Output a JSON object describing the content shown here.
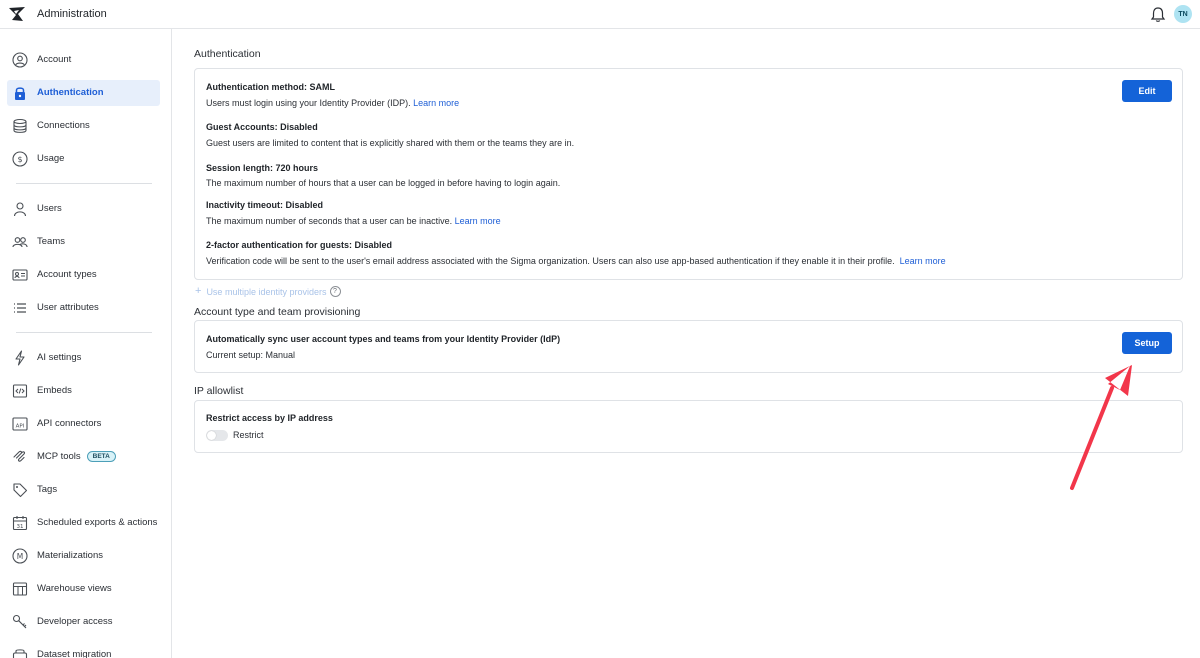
{
  "app": {
    "title": "Administration",
    "avatar_initials": "TN"
  },
  "sidebar": {
    "active": "Authentication",
    "items": [
      {
        "label": "Account",
        "icon": "account-icon"
      },
      {
        "label": "Authentication",
        "icon": "lock-icon"
      },
      {
        "label": "Connections",
        "icon": "database-icon"
      },
      {
        "label": "Usage",
        "icon": "usage-icon"
      },
      {
        "label": "Users",
        "icon": "user-icon"
      },
      {
        "label": "Teams",
        "icon": "teams-icon"
      },
      {
        "label": "Account types",
        "icon": "id-card-icon"
      },
      {
        "label": "User attributes",
        "icon": "list-icon"
      },
      {
        "label": "AI settings",
        "icon": "lightning-icon"
      },
      {
        "label": "Embeds",
        "icon": "embed-icon"
      },
      {
        "label": "API connectors",
        "icon": "api-icon"
      },
      {
        "label": "MCP tools",
        "icon": "mcp-icon",
        "badge": "BETA"
      },
      {
        "label": "Tags",
        "icon": "tag-icon"
      },
      {
        "label": "Scheduled exports & actions",
        "icon": "calendar-icon"
      },
      {
        "label": "Materializations",
        "icon": "materialization-icon"
      },
      {
        "label": "Warehouse views",
        "icon": "table-icon"
      },
      {
        "label": "Developer access",
        "icon": "key-icon"
      },
      {
        "label": "Dataset migration",
        "icon": "migration-icon"
      }
    ]
  },
  "authentication": {
    "section_title": "Authentication",
    "edit_label": "Edit",
    "rows": [
      {
        "title": "Authentication method: SAML",
        "desc": "Users must login using your Identity Provider (IDP).",
        "link": "Learn more"
      },
      {
        "title": "Guest Accounts: Disabled",
        "desc": "Guest users are limited to content that is explicitly shared with them or the teams they are in.",
        "link": ""
      },
      {
        "title": "Session length: 720 hours",
        "desc": "The maximum number of hours that a user can be logged in before having to login again.",
        "link": ""
      },
      {
        "title": "Inactivity timeout: Disabled",
        "desc": "The maximum number of seconds that a user can be inactive.",
        "link": "Learn more"
      },
      {
        "title": "2-factor authentication for guests: Disabled",
        "desc": "Verification code will be sent to the user's email address associated with the Sigma organization. Users can also use app-based authentication if they enable it in their profile.",
        "link": "Learn more"
      }
    ],
    "multi_idp_label": "Use multiple identity providers",
    "help_glyph": "?"
  },
  "provisioning": {
    "section_title": "Account type and team provisioning",
    "title": "Automatically sync user account types and teams from your Identity Provider (IdP)",
    "desc": "Current setup: Manual",
    "setup_label": "Setup"
  },
  "ip_allowlist": {
    "section_title": "IP allowlist",
    "title": "Restrict access by IP address",
    "toggle_label": "Restrict",
    "toggle_on": false
  },
  "colors": {
    "accent": "#1463d8",
    "active_bg": "#e7effb",
    "arrow": "#f2364a"
  }
}
